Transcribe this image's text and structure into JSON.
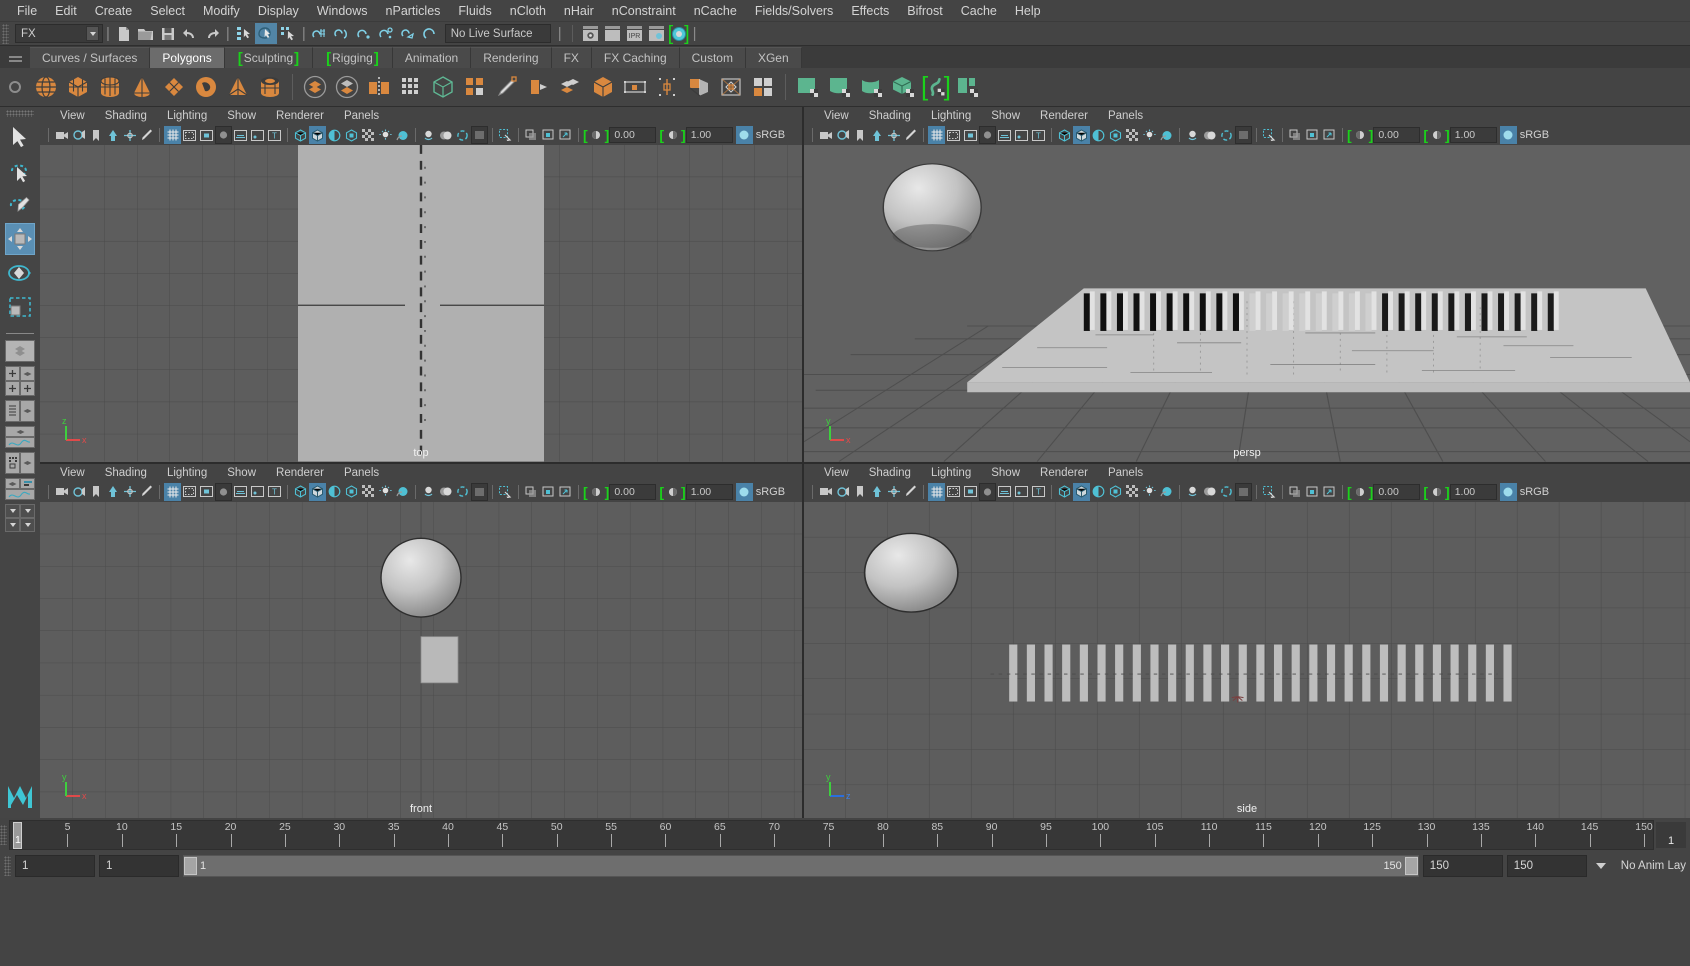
{
  "app": {
    "title": "Autodesk Maya"
  },
  "menubar": {
    "items": [
      "File",
      "Edit",
      "Create",
      "Select",
      "Modify",
      "Display",
      "Windows",
      "nParticles",
      "Fluids",
      "nCloth",
      "nHair",
      "nConstraint",
      "nCache",
      "Fields/Solvers",
      "Effects",
      "Bifrost",
      "Cache",
      "Help"
    ]
  },
  "statusline": {
    "menuset": "FX",
    "live_surface": "No Live Surface",
    "icons_file": [
      "new-scene-icon",
      "open-scene-icon",
      "save-scene-icon",
      "undo-icon",
      "redo-icon"
    ],
    "icons_select_mask": [
      "select-by-hierarchy-icon",
      "select-by-object-type-icon",
      "select-by-component-type-icon"
    ],
    "icons_snap": [
      "snap-to-grid-icon",
      "snap-to-curve-icon",
      "snap-to-point-icon",
      "snap-to-projected-center-icon",
      "snap-to-view-plane-icon",
      "make-live-icon"
    ],
    "icons_render": [
      "render-current-frame-icon",
      "render-sequence-icon",
      "ipr-render-icon",
      "render-settings-icon",
      "hypershade-icon"
    ],
    "selected_button": "select-by-object-type-icon"
  },
  "shelf": {
    "tabs": [
      {
        "label": "Curves / Surfaces",
        "active": false,
        "bracket": "none"
      },
      {
        "label": "Polygons",
        "active": true,
        "bracket": "none"
      },
      {
        "label": "Sculpting",
        "active": false,
        "bracket": "both"
      },
      {
        "label": "Rigging",
        "active": false,
        "bracket": "both"
      },
      {
        "label": "Animation",
        "active": false,
        "bracket": "none"
      },
      {
        "label": "Rendering",
        "active": false,
        "bracket": "none"
      },
      {
        "label": "FX",
        "active": false,
        "bracket": "none"
      },
      {
        "label": "FX Caching",
        "active": false,
        "bracket": "none"
      },
      {
        "label": "Custom",
        "active": false,
        "bracket": "none"
      },
      {
        "label": "XGen",
        "active": false,
        "bracket": "none"
      }
    ],
    "icons": [
      "polygon-sphere-icon",
      "polygon-cube-icon",
      "polygon-cylinder-icon",
      "polygon-cone-icon",
      "polygon-plane-icon",
      "polygon-torus-icon",
      "polygon-pyramid-icon",
      "polygon-pipe-icon",
      "combine-icon",
      "separate-icon",
      "mirror-geometry-icon",
      "smooth-icon",
      "boolean-icon",
      "extrude-icon",
      "multi-cut-icon",
      "bevel-icon",
      "merge-icon",
      "reduce-icon",
      "sculpt-mesh-icon",
      "target-weld-icon",
      "insert-edge-loop-icon",
      "offset-edge-loop-icon",
      "quad-draw-icon",
      "crease-tool-icon",
      "uv-planar-icon",
      "uv-cylindrical-icon",
      "uv-spherical-icon",
      "uv-automatic-icon",
      "uv-unfold-icon",
      "uv-layout-icon"
    ]
  },
  "toolbox": {
    "items": [
      "select-tool-icon",
      "lasso-select-tool-icon",
      "paint-select-tool-icon",
      "move-tool-icon",
      "rotate-tool-icon",
      "scale-tool-icon"
    ],
    "selected": "move-tool-icon",
    "layout_buttons": [
      "single-perspective-layout-icon",
      "four-view-layout-icon",
      "outliner-persp-layout-icon",
      "persp-graph-layout-icon",
      "hypershade-persp-layout-icon",
      "outliner-graph-layout-icon",
      "saved-layouts-icon"
    ],
    "logo": "maya-logo-icon"
  },
  "panels": [
    {
      "id": "top",
      "label": "top",
      "menus": [
        "View",
        "Shading",
        "Lighting",
        "Show",
        "Renderer",
        "Panels"
      ],
      "exposure": "0.00",
      "gamma": "1.00",
      "colorspace": "sRGB"
    },
    {
      "id": "persp",
      "label": "persp",
      "menus": [
        "View",
        "Shading",
        "Lighting",
        "Show",
        "Renderer",
        "Panels"
      ],
      "exposure": "0.00",
      "gamma": "1.00",
      "colorspace": "sRGB"
    },
    {
      "id": "front",
      "label": "front",
      "menus": [
        "View",
        "Shading",
        "Lighting",
        "Show",
        "Renderer",
        "Panels"
      ],
      "exposure": "0.00",
      "gamma": "1.00",
      "colorspace": "sRGB"
    },
    {
      "id": "side",
      "label": "side",
      "menus": [
        "View",
        "Shading",
        "Lighting",
        "Show",
        "Renderer",
        "Panels"
      ],
      "exposure": "0.00",
      "gamma": "1.00",
      "colorspace": "sRGB"
    }
  ],
  "viewport_icons": [
    "select-camera-icon",
    "camera-attributes-icon",
    "bookmarks-icon",
    "image-plane-icon",
    "2d-pan-zoom-icon",
    "grease-pencil-icon",
    "grid-toggle-icon",
    "film-gate-icon",
    "resolution-gate-icon",
    "gate-mask-icon",
    "field-chart-icon",
    "safe-action-icon",
    "safe-title-icon",
    "wireframe-icon",
    "smooth-shade-all-icon",
    "shaded-wireframe-icon",
    "textured-icon",
    "use-all-lights-icon",
    "shadows-icon",
    "screen-space-ao-icon",
    "motion-blur-icon",
    "multisample-aa-icon",
    "depth-of-field-icon",
    "isolate-select-icon",
    "xray-icon",
    "xray-joints-icon",
    "xray-active-components-icon",
    "exposure-icon",
    "gamma-icon"
  ],
  "timeline": {
    "current_frame": "1",
    "end_display": "1",
    "ticks": [
      5,
      10,
      15,
      20,
      25,
      30,
      35,
      40,
      45,
      50,
      55,
      60,
      65,
      70,
      75,
      80,
      85,
      90,
      95,
      100,
      105,
      110,
      115,
      120,
      125,
      130,
      135,
      140,
      145,
      150
    ],
    "range_start": 1,
    "range_end": 150
  },
  "rangeslider": {
    "anim_start": "1",
    "range_start": "1",
    "bar_left_label": "1",
    "bar_right_label": "150",
    "range_end": "150",
    "anim_end": "150",
    "anim_layer": "No Anim Lay"
  },
  "colors": {
    "accent_blue": "#4a82a8",
    "shelf_orange": "#d9883f",
    "shelf_green": "#5cb58f",
    "bracket_green": "#1bd21b",
    "bg_dark": "#444444",
    "viewport_gray": "#5d5d5d"
  },
  "scene": {
    "description": "Row of domino boxes on a ground plane with a sphere above-left",
    "domino_count": 29,
    "objects": [
      "sphere",
      "ground-plane",
      "domino-row"
    ]
  }
}
